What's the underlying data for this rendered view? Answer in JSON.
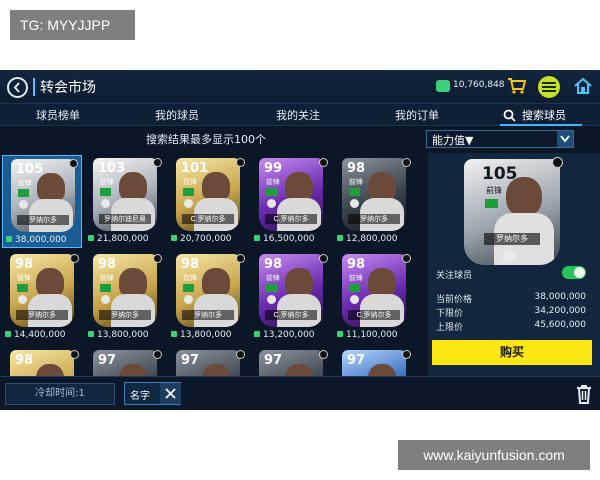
{
  "watermarks": {
    "top": "TG: MYYJJPP",
    "bottom": "www.kaiyunfusion.com"
  },
  "header": {
    "title": "转会市场",
    "coins": "10,760,848"
  },
  "tabs": [
    "球员榜单",
    "我的球员",
    "我的关注",
    "我的订单"
  ],
  "active_tab": "搜索球员",
  "result_note": "搜索结果最多显示100个",
  "sort": {
    "label": "能力值▼"
  },
  "cards": [
    {
      "rating": "105",
      "pos": "前锋",
      "name": "罗纳尔多",
      "price": "38,000,000",
      "tone": "silver",
      "selected": true
    },
    {
      "rating": "103",
      "pos": "前锋",
      "name": "罗纳尔迪尼奥",
      "price": "21,800,000",
      "tone": "silver"
    },
    {
      "rating": "101",
      "pos": "前锋",
      "name": "C.罗纳尔多",
      "price": "20,700,000",
      "tone": "gold"
    },
    {
      "rating": "99",
      "pos": "前锋",
      "name": "C.罗纳尔多",
      "price": "16,500,000",
      "tone": "purple"
    },
    {
      "rating": "98",
      "pos": "前锋",
      "name": "罗纳尔多",
      "price": "12,800,000",
      "tone": "dark"
    },
    {
      "rating": "98",
      "pos": "前锋",
      "name": "罗纳尔多",
      "price": "14,400,000",
      "tone": "gold"
    },
    {
      "rating": "98",
      "pos": "前锋",
      "name": "罗纳尔多",
      "price": "13,800,000",
      "tone": "gold"
    },
    {
      "rating": "98",
      "pos": "前锋",
      "name": "罗纳尔多",
      "price": "13,800,000",
      "tone": "gold"
    },
    {
      "rating": "98",
      "pos": "前锋",
      "name": "C.罗纳尔多",
      "price": "13,200,000",
      "tone": "purple"
    },
    {
      "rating": "98",
      "pos": "前锋",
      "name": "C.罗纳尔多",
      "price": "11,100,000",
      "tone": "purple"
    },
    {
      "rating": "98",
      "tone": "gold"
    },
    {
      "rating": "97",
      "tone": "dark"
    },
    {
      "rating": "97",
      "tone": "dark"
    },
    {
      "rating": "97",
      "tone": "dark"
    },
    {
      "rating": "97",
      "tone": "blue"
    }
  ],
  "detail": {
    "rating": "105",
    "pos": "前锋",
    "name": "罗纳尔多",
    "follow_label": "关注球员",
    "follow_on": true,
    "prices": [
      {
        "label": "当前价格",
        "value": "38,000,000"
      },
      {
        "label": "下限价",
        "value": "34,200,000"
      },
      {
        "label": "上限价",
        "value": "45,600,000"
      }
    ],
    "buy_label": "购买"
  },
  "bottom": {
    "cooldown": "冷却时间:1",
    "filter_chip": "名字"
  },
  "colors": {
    "accent": "#3fb7ff",
    "coin": "#3bd07a",
    "buy": "#ffe714",
    "toggle_on": "#27c45a"
  },
  "icons": [
    "back-icon",
    "coin-icon",
    "cart-icon",
    "sbc-icon",
    "home-icon",
    "search-icon",
    "chevron-down-icon",
    "close-icon",
    "trash-icon",
    "star-icon"
  ]
}
